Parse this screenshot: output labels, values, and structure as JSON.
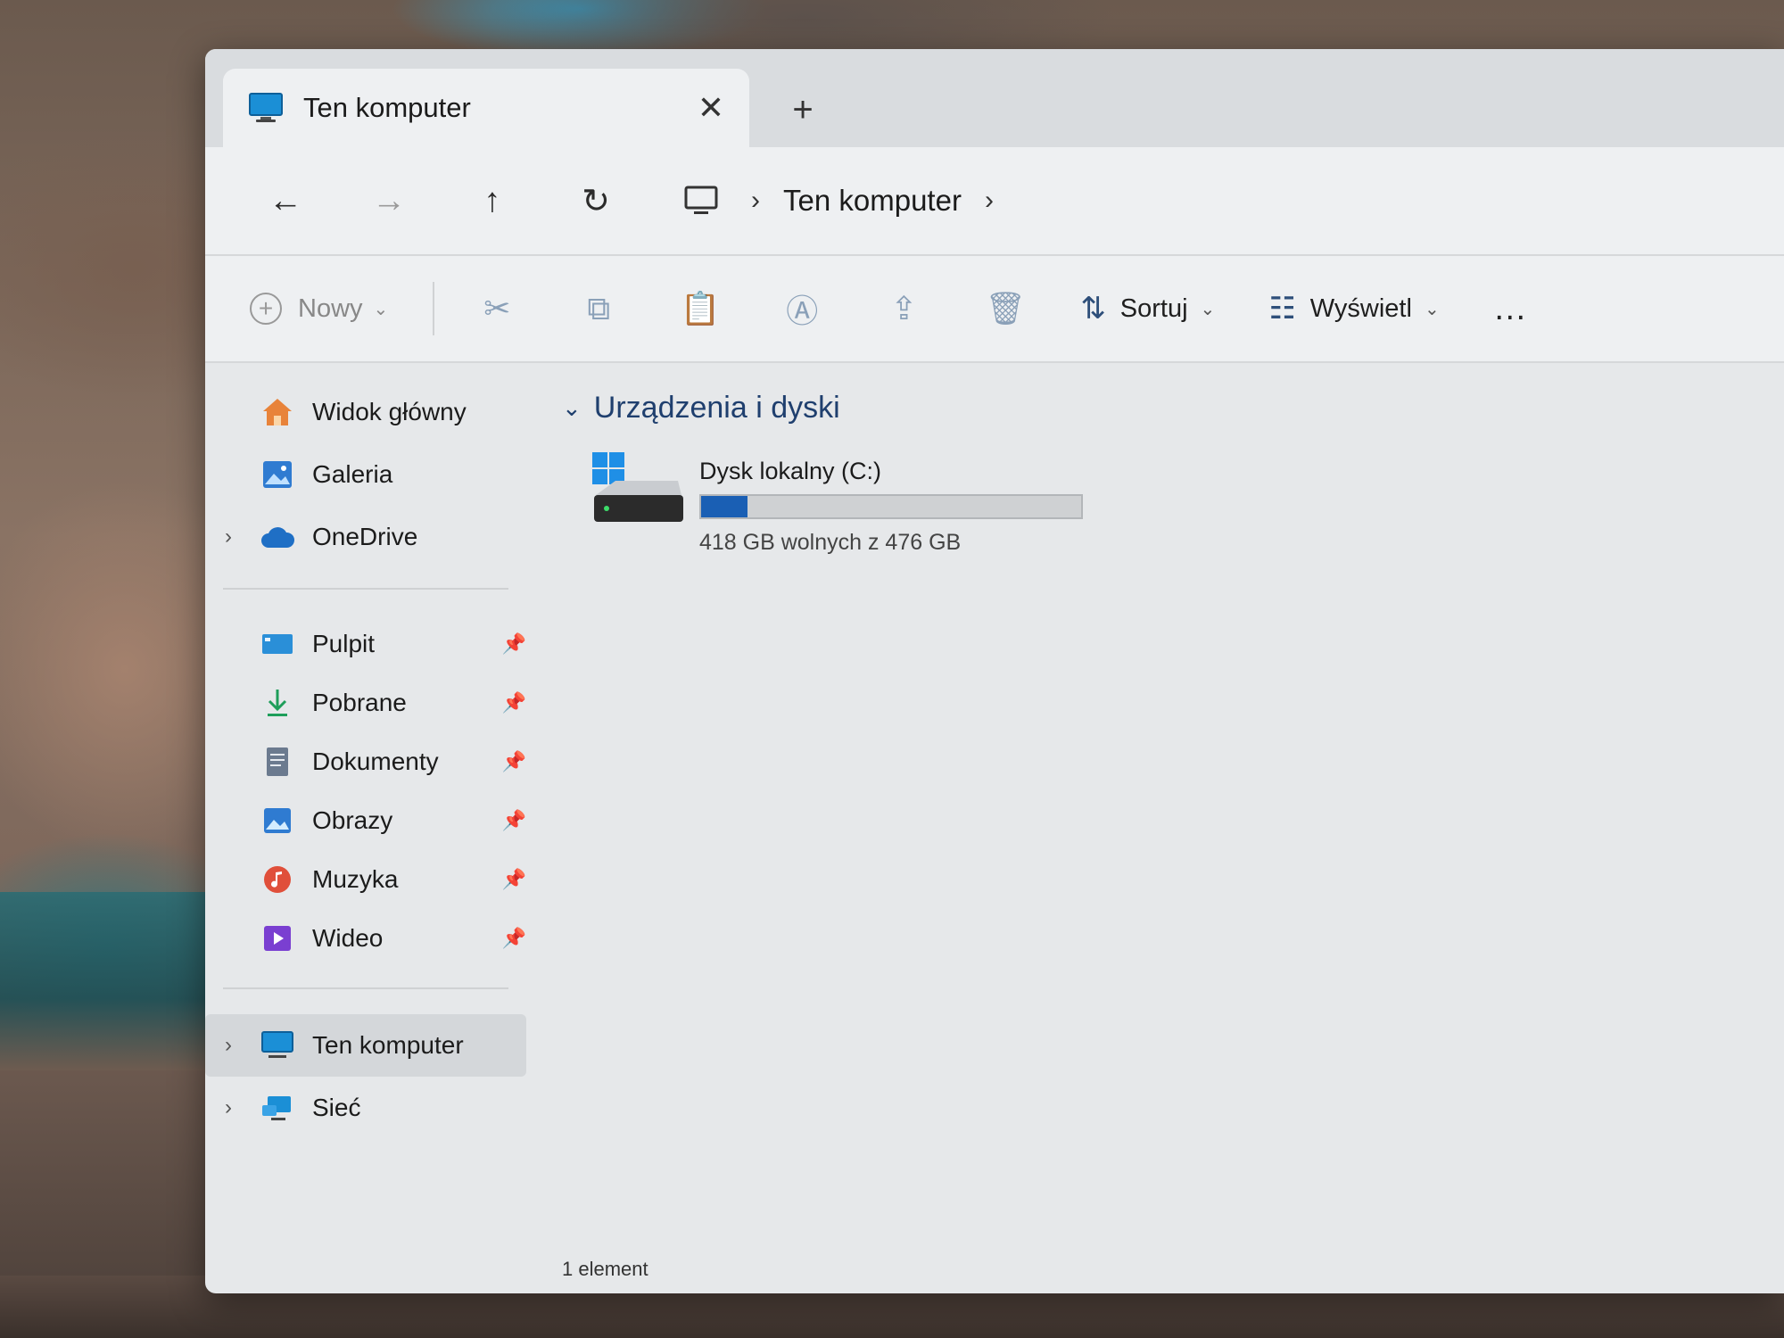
{
  "window": {
    "tab_title": "Ten komputer",
    "close_glyph": "✕",
    "new_tab_glyph": "+"
  },
  "navbar": {
    "back": "←",
    "forward": "→",
    "up": "↑",
    "refresh": "↻",
    "separator": "›",
    "breadcrumb": "Ten komputer",
    "trailing_separator": "›"
  },
  "toolbar": {
    "new_label": "Nowy",
    "new_plus": "+",
    "new_chevron": "⌄",
    "cut": "✂",
    "copy": "⧉",
    "paste": "📋",
    "rename": "Ⓐ",
    "share": "⇪",
    "delete": "🗑",
    "sort_label": "Sortuj",
    "sort_icon": "⇅",
    "view_label": "Wyświetl",
    "view_icon": "☷",
    "chevron": "⌄",
    "more": "…"
  },
  "sidebar": {
    "expander": "›",
    "pin": "📌",
    "top": [
      {
        "label": "Widok główny",
        "icon": "home-icon"
      },
      {
        "label": "Galeria",
        "icon": "gallery-icon"
      },
      {
        "label": "OneDrive",
        "icon": "cloud-icon"
      }
    ],
    "quick_access": [
      {
        "label": "Pulpit",
        "icon": "desktop-icon"
      },
      {
        "label": "Pobrane",
        "icon": "download-icon"
      },
      {
        "label": "Dokumenty",
        "icon": "documents-icon"
      },
      {
        "label": "Obrazy",
        "icon": "pictures-icon"
      },
      {
        "label": "Muzyka",
        "icon": "music-icon"
      },
      {
        "label": "Wideo",
        "icon": "video-icon"
      }
    ],
    "bottom": [
      {
        "label": "Ten komputer",
        "icon": "computer-icon"
      },
      {
        "label": "Sieć",
        "icon": "network-icon"
      }
    ]
  },
  "main": {
    "group_chevron": "⌄",
    "group_title": "Urządzenia i dyski",
    "drive": {
      "name": "Dysk lokalny (C:)",
      "space_text": "418 GB wolnych z 476 GB",
      "used_fraction": 0.122
    }
  },
  "status": {
    "item_count": "1 element"
  },
  "colors": {
    "accent": "#1a5fb4",
    "group_header": "#1f3f6e"
  }
}
